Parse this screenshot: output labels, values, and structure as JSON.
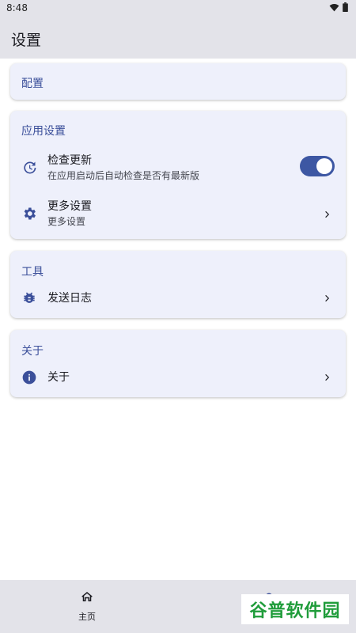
{
  "status_bar": {
    "time": "8:48",
    "icons": [
      "wifi-icon",
      "battery-icon"
    ]
  },
  "app_bar": {
    "title": "设置"
  },
  "cards": {
    "config": {
      "title": "配置"
    },
    "app_settings": {
      "title": "应用设置",
      "check_update": {
        "icon": "history-icon",
        "label": "检查更新",
        "description": "在应用启动后自动检查是否有最新版",
        "enabled": true
      },
      "more_settings": {
        "icon": "gear-icon",
        "label": "更多设置",
        "description": "更多设置"
      }
    },
    "tools": {
      "title": "工具",
      "send_log": {
        "icon": "bug-icon",
        "label": "发送日志"
      }
    },
    "about": {
      "title": "关于",
      "about_item": {
        "icon": "info-icon",
        "label": "关于"
      }
    }
  },
  "bottom_nav": {
    "home": {
      "icon": "home-icon",
      "label": "主页"
    },
    "settings": {
      "icon": "settings-icon"
    }
  },
  "watermark": {
    "text": "谷普软件园"
  },
  "colors": {
    "accent": "#3b4f9a",
    "card_bg": "#eef0fb",
    "bar_bg": "#e3e3e9",
    "toggle_on": "#3d57a3"
  }
}
